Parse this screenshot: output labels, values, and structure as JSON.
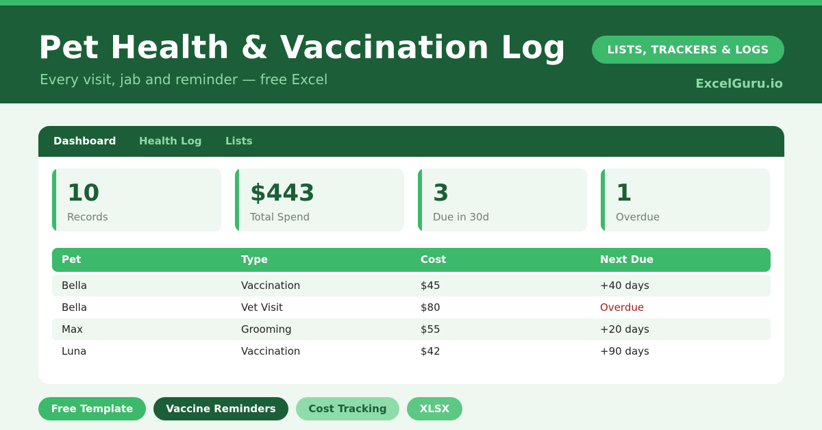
{
  "header": {
    "title": "Pet Health & Vaccination Log",
    "subtitle": "Every visit, jab and reminder — free Excel",
    "pill": "LISTS, TRACKERS & LOGS",
    "brand": "ExcelGuru.io"
  },
  "tabs": [
    {
      "label": "Dashboard",
      "active": true
    },
    {
      "label": "Health Log",
      "active": false
    },
    {
      "label": "Lists",
      "active": false
    }
  ],
  "kpis": [
    {
      "value": "10",
      "label": "Records"
    },
    {
      "value": "$443",
      "label": "Total Spend"
    },
    {
      "value": "3",
      "label": "Due in 30d"
    },
    {
      "value": "1",
      "label": "Overdue"
    }
  ],
  "table": {
    "columns": [
      "Pet",
      "Type",
      "Cost",
      "Next Due"
    ],
    "rows": [
      {
        "pet": "Bella",
        "type": "Vaccination",
        "cost": "$45",
        "next_due": "+40 days"
      },
      {
        "pet": "Bella",
        "type": "Vet Visit",
        "cost": "$80",
        "next_due": "Overdue"
      },
      {
        "pet": "Max",
        "type": "Grooming",
        "cost": "$55",
        "next_due": "+20 days"
      },
      {
        "pet": "Luna",
        "type": "Vaccination",
        "cost": "$42",
        "next_due": "+90 days"
      }
    ]
  },
  "tags": [
    "Free Template",
    "Vaccine Reminders",
    "Cost Tracking",
    "XLSX"
  ],
  "colors": {
    "dark_green": "#1b5e37",
    "accent_green": "#3cb96b",
    "light_green_text": "#8fd8a8",
    "background": "#eef7f0",
    "overdue_red": "#a31d1d"
  }
}
